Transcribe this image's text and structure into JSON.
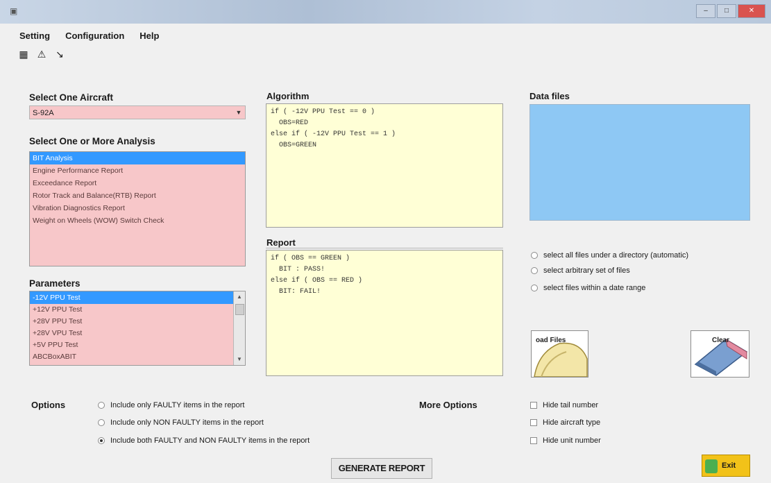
{
  "window": {
    "controls": [
      "–",
      "□",
      "✕"
    ]
  },
  "menu": {
    "items": [
      "Setting",
      "Configuration",
      "Help"
    ]
  },
  "aircraft": {
    "label": "Select One Aircraft",
    "selected": "S-92A"
  },
  "analysis": {
    "label": "Select One or More Analysis",
    "items": [
      "BIT Analysis",
      "Engine Performance Report",
      "Exceedance Report",
      "Rotor Track and Balance(RTB) Report",
      "Vibration Diagnostics Report",
      "Weight on Wheels (WOW) Switch Check"
    ],
    "selected_index": 0
  },
  "parameters": {
    "label": "Parameters",
    "items": [
      "-12V PPU Test",
      "+12V PPU Test",
      "+28V PPU Test",
      "+28V VPU Test",
      "+5V PPU Test",
      "ABCBoxABIT"
    ],
    "selected_index": 0
  },
  "algorithm": {
    "label": "Algorithm",
    "text": "if ( -12V PPU Test == 0 )\n  OBS=RED\nelse if ( -12V PPU Test == 1 )\n  OBS=GREEN"
  },
  "report": {
    "label": "Report",
    "text": "if ( OBS == GREEN )\n  BIT : PASS!\nelse if ( OBS == RED )\n  BIT: FAIL!"
  },
  "datafiles": {
    "label": "Data files"
  },
  "file_selection": {
    "options": [
      "select all files under a directory (automatic)",
      "select arbitrary set of files",
      "select files within a date range"
    ]
  },
  "buttons": {
    "load_files": "oad Files",
    "clear": "Clear",
    "generate": "GENERATE REPORT",
    "exit": "Exit"
  },
  "options": {
    "label": "Options",
    "items": [
      "Include only FAULTY items in the report",
      "Include only NON FAULTY items in the report",
      "Include both FAULTY and NON FAULTY items in the report"
    ],
    "selected_index": 2
  },
  "more_options": {
    "label": "More Options",
    "items": [
      "Hide tail number",
      "Hide aircraft type",
      "Hide unit number"
    ]
  },
  "colors": {
    "pink_list": "#f7c7c9",
    "selection": "#3399ff",
    "yellow_text": "#ffffd6",
    "blue_panel": "#8ec8f4",
    "exit_yellow": "#f2c219"
  }
}
